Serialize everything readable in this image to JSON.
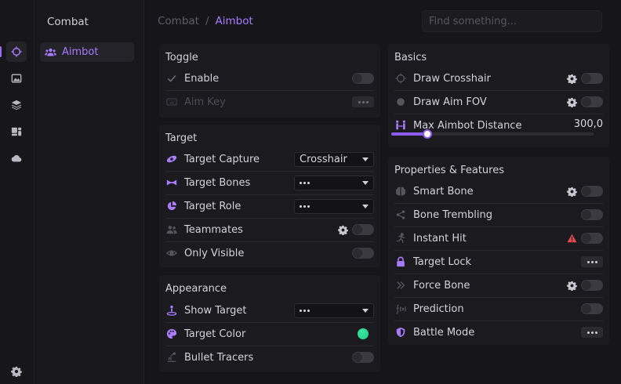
{
  "sidebar": {
    "category_title": "Combat",
    "active_item": "Aimbot",
    "icons": [
      "crosshair-icon",
      "image-icon",
      "layers-icon",
      "dashboard-icon",
      "cloud-icon",
      "settings-icon"
    ]
  },
  "breadcrumb": {
    "root": "Combat",
    "separator": "/",
    "current": "Aimbot"
  },
  "search": {
    "placeholder": "Find something..."
  },
  "accent_color": "#a87bff",
  "toggle_panel": {
    "title": "Toggle",
    "rows": [
      {
        "label": "Enable",
        "icon": "check-icon",
        "control": "toggle",
        "on": false
      },
      {
        "label": "Aim Key",
        "icon": "keyboard-icon",
        "control": "more",
        "disabled": true
      }
    ]
  },
  "target_panel": {
    "title": "Target",
    "rows": [
      {
        "label": "Target Capture",
        "icon": "capture-icon",
        "control": "select",
        "value": "Crosshair"
      },
      {
        "label": "Target Bones",
        "icon": "bone-icon",
        "control": "select",
        "value": "..."
      },
      {
        "label": "Target Role",
        "icon": "pie-icon",
        "control": "select",
        "value": "..."
      },
      {
        "label": "Teammates",
        "icon": "users-icon",
        "control": "toggle",
        "gear": true,
        "on": false
      },
      {
        "label": "Only Visible",
        "icon": "eye-icon",
        "control": "toggle",
        "on": false
      }
    ]
  },
  "appearance_panel": {
    "title": "Appearance",
    "rows": [
      {
        "label": "Show Target",
        "icon": "person-target-icon",
        "control": "select",
        "value": "..."
      },
      {
        "label": "Target Color",
        "icon": "palette-icon",
        "control": "color",
        "value": "#1fc98a"
      },
      {
        "label": "Bullet Tracers",
        "icon": "tracer-icon",
        "control": "toggle",
        "on": false
      }
    ]
  },
  "basics_panel": {
    "title": "Basics",
    "rows": [
      {
        "label": "Draw Crosshair",
        "icon": "crosshair-icon",
        "control": "toggle",
        "gear": true,
        "on": false
      },
      {
        "label": "Draw Aim FOV",
        "icon": "circle-icon",
        "control": "toggle",
        "gear": true,
        "on": false
      },
      {
        "label": "Max Aimbot Distance",
        "icon": "distance-icon",
        "control": "slider",
        "value": "300,0",
        "fraction": 0.18
      }
    ]
  },
  "properties_panel": {
    "title": "Properties & Features",
    "rows": [
      {
        "label": "Smart Bone",
        "icon": "brain-icon",
        "control": "toggle",
        "gear": true,
        "on": false
      },
      {
        "label": "Bone Trembling",
        "icon": "share-icon",
        "control": "toggle",
        "on": false
      },
      {
        "label": "Instant Hit",
        "icon": "run-icon",
        "control": "toggle",
        "warning": true,
        "on": false
      },
      {
        "label": "Target Lock",
        "icon": "lock-icon",
        "control": "more"
      },
      {
        "label": "Force Bone",
        "icon": "chevrons-right-icon",
        "control": "toggle",
        "gear": true,
        "on": false
      },
      {
        "label": "Prediction",
        "icon": "function-icon",
        "control": "toggle",
        "on": false
      },
      {
        "label": "Battle Mode",
        "icon": "shield-icon",
        "control": "more"
      }
    ]
  }
}
